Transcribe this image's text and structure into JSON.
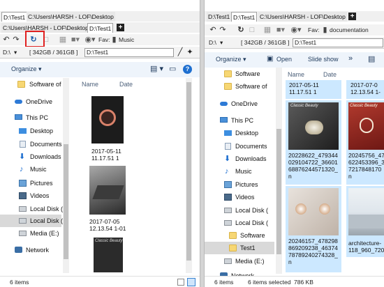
{
  "left": {
    "tabs_row1": [
      "D:\\Test1",
      "C:\\Users\\HARSH - LOF\\Desktop"
    ],
    "tabs_row2": [
      "C:\\Users\\HARSH - LOF\\Desktop",
      "D:\\Test1"
    ],
    "fav_label": "Fav:",
    "fav_folder": "Music",
    "drive": "D:\\",
    "space": "[ 342GB / 361GB ]",
    "path": "D:\\Test1",
    "organize": "Organize",
    "nav": [
      "Software of",
      "OneDrive",
      "This PC",
      "Desktop",
      "Documents",
      "Downloads",
      "Music",
      "Pictures",
      "Videos",
      "Local Disk (",
      "Local Disk (",
      "Media (E:)",
      "Network"
    ],
    "columns": [
      "Name",
      "Date"
    ],
    "files": [
      {
        "text": "2017-05-11\n11.17.51 1"
      },
      {
        "text": "2017-07-05\n12.13.54 1-01"
      }
    ],
    "status": "6 items"
  },
  "right": {
    "tabs": [
      "D:\\Test1",
      "D:\\Test1",
      "C:\\Users\\HARSH - LOF\\Desktop"
    ],
    "fav_label": "Fav:",
    "fav_folder": "documentation",
    "drive": "D:\\",
    "space": "[ 342GB / 361GB ]",
    "path": "D:\\Test1",
    "organize": "Organize",
    "open": "Open",
    "slideshow": "Slide show",
    "more": "»",
    "nav": [
      "Software",
      "Software of",
      "OneDrive",
      "This PC",
      "Desktop",
      "Documents",
      "Downloads",
      "Music",
      "Pictures",
      "Videos",
      "Local Disk (",
      "Local Disk (",
      "Software",
      "Test1",
      "Media (E:)",
      "Network"
    ],
    "columns": [
      "Name",
      "Date"
    ],
    "files": [
      {
        "text": "2017-05-11\n11.17.51 1"
      },
      {
        "text": "2017-07-0\n12.13.54 1-"
      },
      {
        "text": "20228622_479344\n029104722_36601\n68876244571320_\nn"
      },
      {
        "text": "20245756_47\n622453396_3\n7217848170\nn"
      },
      {
        "text": "20246157_478298\n869209238_46374\n78789240274328_\nn"
      },
      {
        "text": "architecture-\n118_960_720"
      }
    ],
    "status_items": "6 items",
    "status_selected": "6 items selected",
    "status_size": "786 KB",
    "thumb_captions": [
      "Classic Beauty",
      "Classic Beauty"
    ]
  },
  "colors": {
    "accent": "#0a74da",
    "selection": "#cce8ff",
    "highlight_box": "#e02020"
  }
}
